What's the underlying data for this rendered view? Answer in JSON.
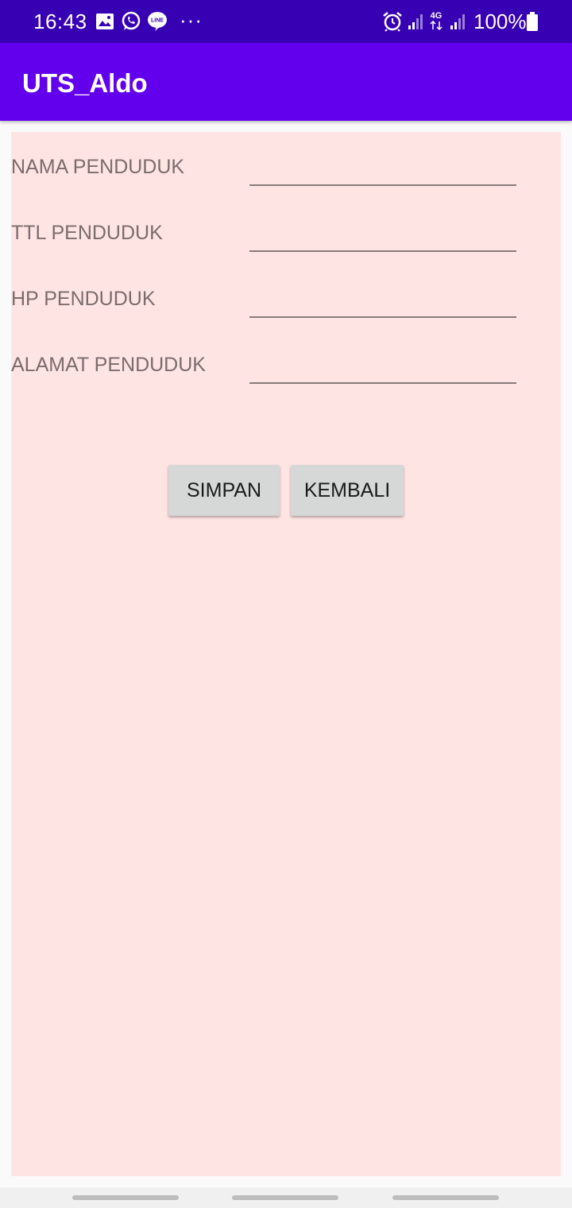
{
  "status_bar": {
    "time": "16:43",
    "notification_icons": [
      "image-icon",
      "whatsapp-icon",
      "line-icon"
    ],
    "more": "···",
    "network": "4G",
    "battery": "100%"
  },
  "app_bar": {
    "title": "UTS_Aldo"
  },
  "form": {
    "fields": [
      {
        "label": "NAMA PENDUDUK",
        "value": ""
      },
      {
        "label": "TTL PENDUDUK",
        "value": ""
      },
      {
        "label": "HP PENDUDUK",
        "value": ""
      },
      {
        "label": "ALAMAT PENDUDUK",
        "value": ""
      }
    ],
    "save_label": "SIMPAN",
    "back_label": "KEMBALI"
  },
  "colors": {
    "status_bar": "#3700b3",
    "app_bar": "#6200ee",
    "form_background": "#ffe4e4",
    "button": "#d6d7d7"
  }
}
